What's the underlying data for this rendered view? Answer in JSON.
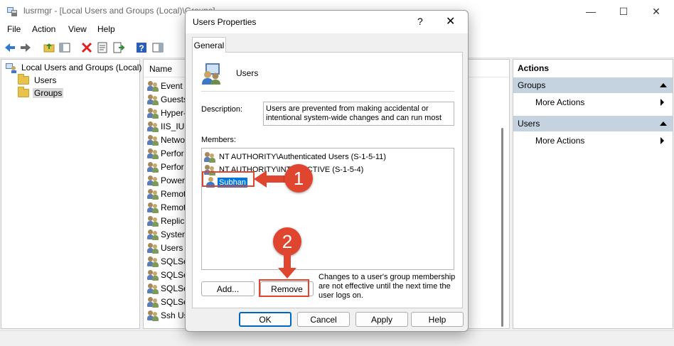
{
  "window": {
    "title": "lusrmgr - [Local Users and Groups (Local)\\Groups]",
    "minimize_glyph": "—",
    "maximize_glyph": "☐",
    "close_glyph": "✕"
  },
  "menu": [
    "File",
    "Action",
    "View",
    "Help"
  ],
  "toolbar": {
    "icons": [
      "back-icon",
      "forward-icon",
      "up-folder-icon",
      "show-hide-tree-icon",
      "delete-icon",
      "properties-icon",
      "export-list-icon",
      "help-icon",
      "show-action-pane-icon"
    ]
  },
  "tree": {
    "root": "Local Users and Groups (Local)",
    "items": [
      "Users",
      "Groups"
    ],
    "selected": "Groups"
  },
  "list": {
    "column_header": "Name",
    "rows": [
      "Event L",
      "Guests",
      "Hyper-",
      "IIS_IUSR",
      "Netwo",
      "Perfor",
      "Perfor",
      "Power",
      "Remote",
      "Remote",
      "Replica",
      "System",
      "Users",
      "SQLSer",
      "SQLSer",
      "SQLSer",
      "SQLSer",
      "Ssh Use"
    ]
  },
  "actions": {
    "header": "Actions",
    "sections": [
      {
        "title": "Groups",
        "item": "More Actions"
      },
      {
        "title": "Users",
        "item": "More Actions"
      }
    ]
  },
  "dialog": {
    "title": "Users Properties",
    "help_glyph": "?",
    "close_glyph": "✕",
    "tab": "General",
    "group_name": "Users",
    "description_label": "Description:",
    "description_value": "Users are prevented from making accidental or intentional system-wide changes and can run most",
    "members_label": "Members:",
    "members": [
      "NT AUTHORITY\\Authenticated Users (S-1-5-11)",
      "NT AUTHORITY\\INTERACTIVE (S-1-5-4)",
      "Subhan"
    ],
    "selected_member": "Subhan",
    "add_label": "Add...",
    "remove_label": "Remove",
    "note": "Changes to a user's group membership are not effective until the next time the user logs on.",
    "ok_label": "OK",
    "cancel_label": "Cancel",
    "apply_label": "Apply",
    "help_label": "Help"
  },
  "annotations": {
    "step1": "1",
    "step2": "2",
    "color": "#e0452f"
  }
}
